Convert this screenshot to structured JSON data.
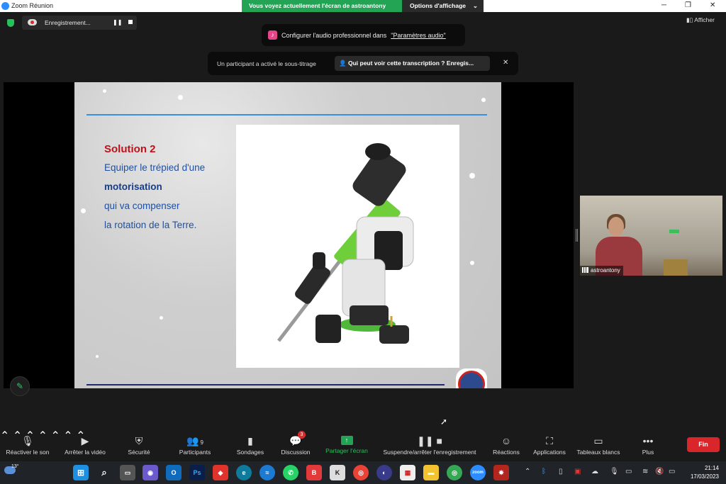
{
  "window": {
    "title": "Zoom Réunion",
    "share_banner": "Vous voyez actuellement l'écran de astroantony",
    "view_options": "Options d'affichage"
  },
  "recording": {
    "label": "Enregistrement..."
  },
  "afficher_label": "Afficher",
  "audio_notice": {
    "text": "Configurer l'audio professionnel dans",
    "link": "\"Paramètres audio\""
  },
  "caption_notice": {
    "text": "Un participant a activé le sous-titrage",
    "button": "Qui peut voir cette transcription ? Enregis..."
  },
  "slide": {
    "title": "Solution 2",
    "lines": [
      "Equiper le trépied d'une",
      "motorisation",
      "qui va compenser",
      "la rotation de la Terre."
    ]
  },
  "participant": {
    "name": "astroantony"
  },
  "toolbar": {
    "mute": "Réactiver le son",
    "video": "Arrêter la vidéo",
    "security": "Sécurité",
    "participants": "Participants",
    "participants_count": "9",
    "polls": "Sondages",
    "chat": "Discussion",
    "chat_badge": "3",
    "share": "Partager l'écran",
    "recording": "Suspendre/arrêter l'enregistrement",
    "reactions": "Réactions",
    "apps": "Applications",
    "whiteboards": "Tableaux blancs",
    "more": "Plus",
    "end": "Fin"
  },
  "taskbar": {
    "temperature": "13°",
    "time": "21:14",
    "date": "17/03/2023"
  },
  "colors": {
    "zoom_green": "#23a455",
    "end_red": "#d9262a",
    "slide_title_red": "#c0101a",
    "slide_text_blue": "#1f4f9e"
  }
}
